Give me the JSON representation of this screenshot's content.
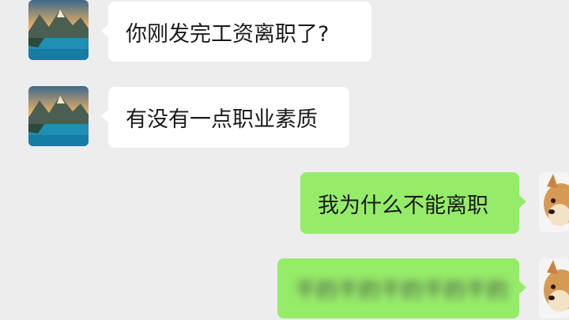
{
  "messages": [
    {
      "side": "received",
      "text": "你刚发完工资离职了?",
      "avatar": "mountain-lake-avatar"
    },
    {
      "side": "received",
      "text": "有没有一点职业素质",
      "avatar": "mountain-lake-avatar"
    },
    {
      "side": "sent",
      "text": "我为什么不能离职",
      "avatar": "shiba-dog-avatar"
    },
    {
      "side": "sent",
      "text": "干的干的干的干的干的",
      "avatar": "shiba-dog-avatar",
      "blurred": true
    }
  ],
  "colors": {
    "background": "#ededed",
    "received_bubble": "#ffffff",
    "sent_bubble": "#95ec69"
  }
}
